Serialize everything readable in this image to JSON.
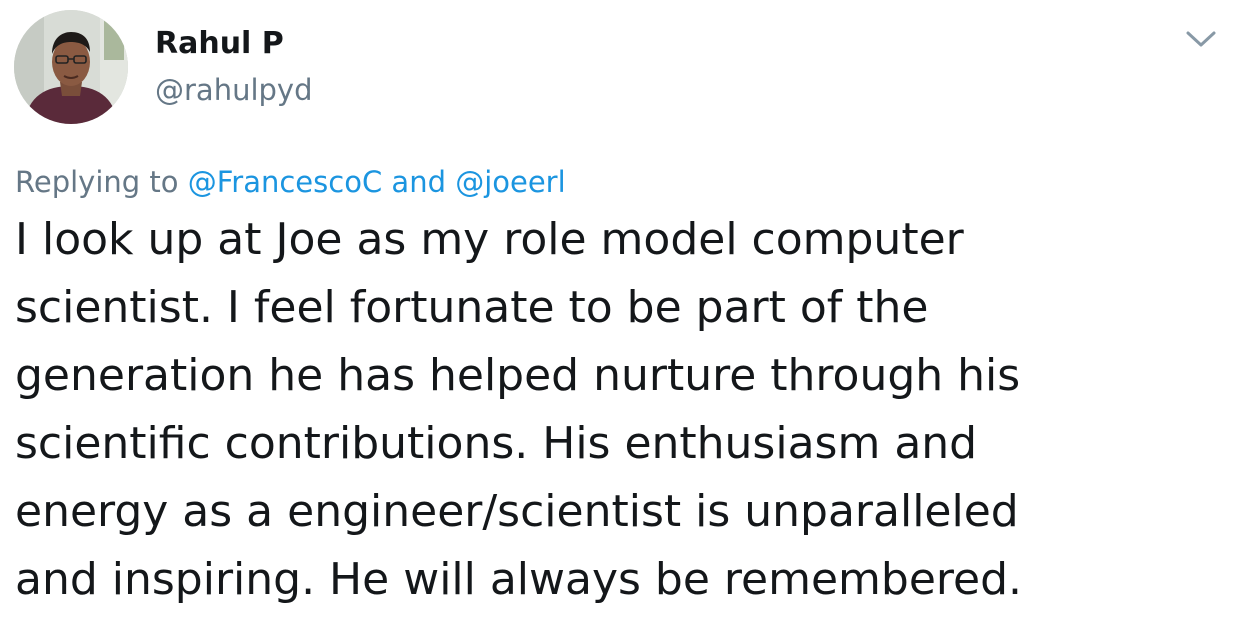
{
  "author": {
    "display_name": "Rahul P",
    "handle": "@rahulpyd",
    "avatar_icon": "user-avatar-photo"
  },
  "menu": {
    "icon": "chevron-down-icon"
  },
  "reply_context": {
    "prefix": "Replying to ",
    "mention_1": "@FrancescoC",
    "conjunction": " and ",
    "mention_2": "@joeerl"
  },
  "tweet": {
    "text": "I look up at Joe as my role model computer\nscientist. I feel fortunate to be part of the\ngeneration he has helped nurture through his\nscientific contributions. His enthusiasm and\nenergy as a engineer/scientist is unparalleled\nand inspiring. He will always be remembered."
  },
  "colors": {
    "text_primary": "#14171a",
    "text_secondary": "#657786",
    "link": "#1b95e0"
  }
}
